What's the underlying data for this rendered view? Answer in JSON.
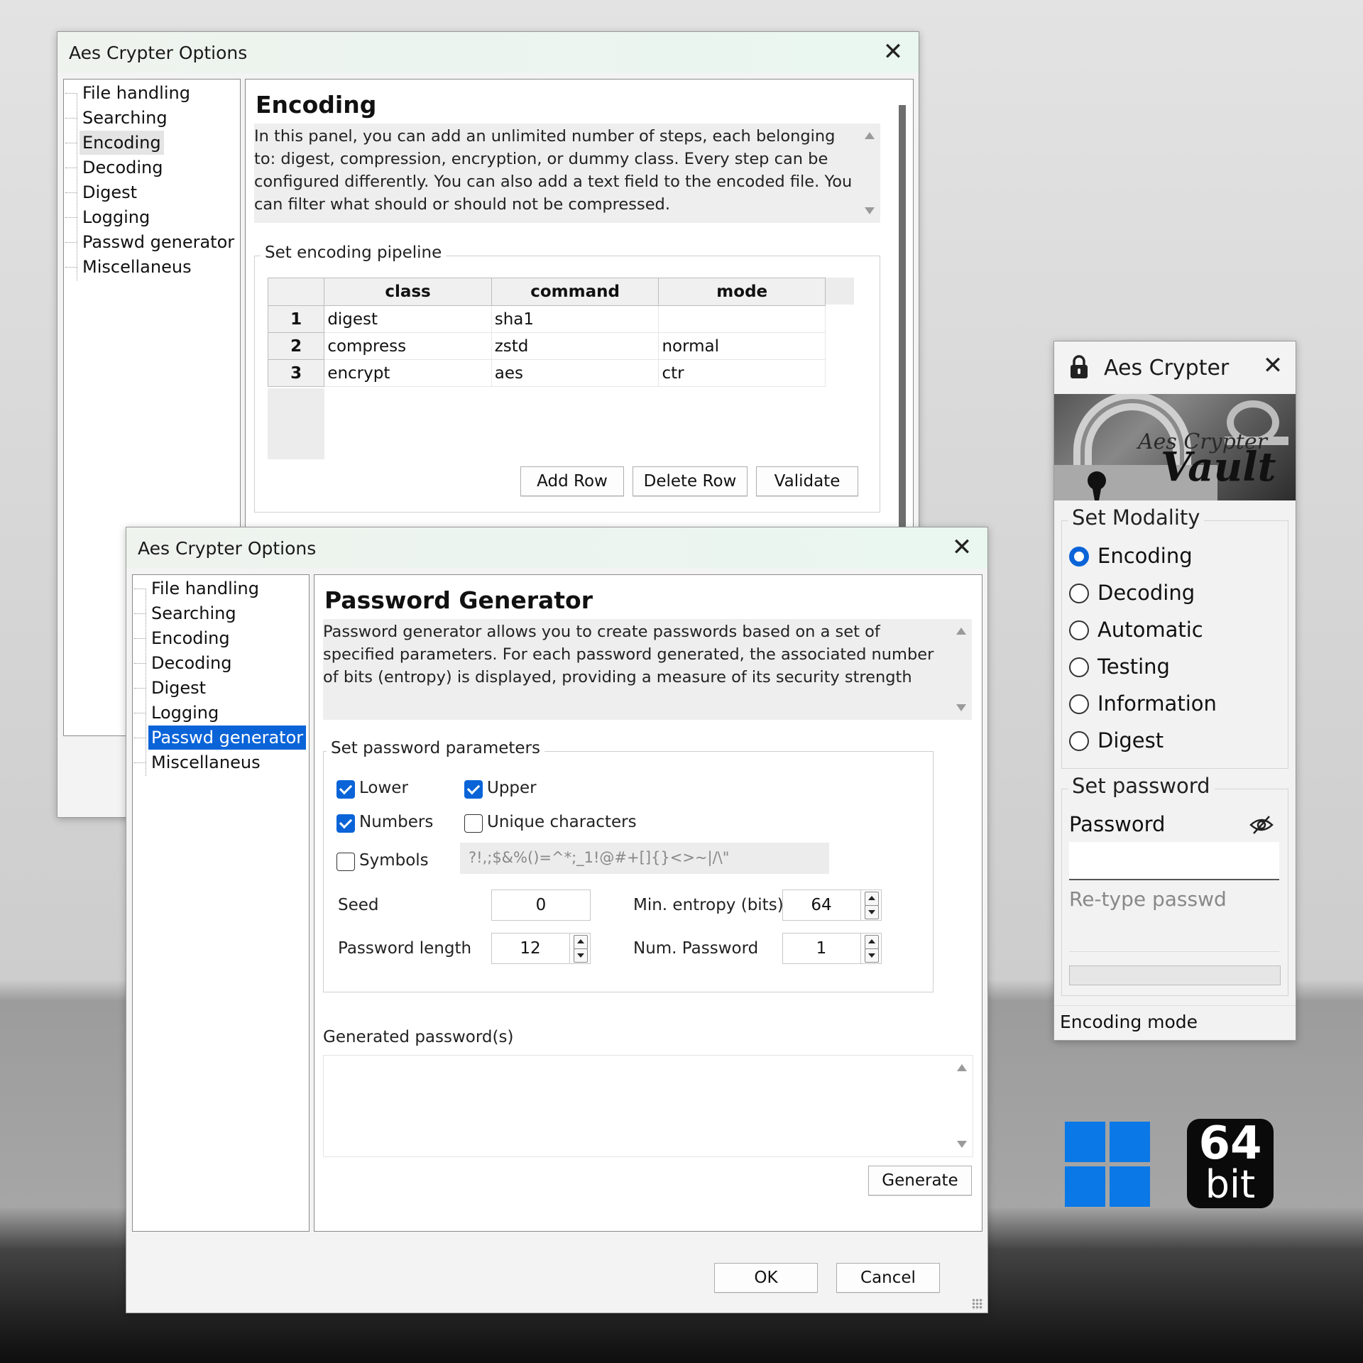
{
  "options_back": {
    "title": "Aes Crypter Options",
    "tree": [
      "File handling",
      "Searching",
      "Encoding",
      "Decoding",
      "Digest",
      "Logging",
      "Passwd generator",
      "Miscellaneus"
    ],
    "panel_title": "Encoding",
    "description": "In this panel, you can add an unlimited number of steps, each belonging to: digest, compression, encryption, or dummy class. Every step can be configured differently. You can also add a text field to the encoded file. You can filter what should or should not be compressed.",
    "pipeline": {
      "group_label": "Set encoding pipeline",
      "columns": [
        "class",
        "command",
        "mode"
      ],
      "rows": [
        {
          "n": "1",
          "class": "digest",
          "command": "sha1",
          "mode": ""
        },
        {
          "n": "2",
          "class": "compress",
          "command": "zstd",
          "mode": "normal"
        },
        {
          "n": "3",
          "class": "encrypt",
          "command": "aes",
          "mode": "ctr"
        }
      ],
      "add_row": "Add Row",
      "delete_row": "Delete Row",
      "validate": "Validate"
    }
  },
  "options_front": {
    "title": "Aes Crypter Options",
    "tree": [
      "File handling",
      "Searching",
      "Encoding",
      "Decoding",
      "Digest",
      "Logging",
      "Passwd generator",
      "Miscellaneus"
    ],
    "panel_title": "Password Generator",
    "description": "Password generator allows you to create passwords based on a set of specified parameters. For each password generated, the associated number of bits (entropy) is displayed, providing a measure of its security strength",
    "params": {
      "group_label": "Set password parameters",
      "lower": {
        "label": "Lower",
        "checked": true
      },
      "upper": {
        "label": "Upper",
        "checked": true
      },
      "numbers": {
        "label": "Numbers",
        "checked": true
      },
      "unique": {
        "label": "Unique characters",
        "checked": false
      },
      "symbols": {
        "label": "Symbols",
        "checked": false
      },
      "symbol_set": "?!,;$&%()=^*;_1!@#+[]{}<>~|/\\\"",
      "seed_label": "Seed",
      "seed": "0",
      "min_entropy_label": "Min. entropy (bits)",
      "min_entropy": "64",
      "length_label": "Password length",
      "length": "12",
      "num_label": "Num. Password",
      "num": "1"
    },
    "generated_label": "Generated password(s)",
    "generate": "Generate",
    "ok": "OK",
    "cancel": "Cancel"
  },
  "crypter": {
    "title": "Aes Crypter",
    "banner_line1": "Aes Crypter",
    "banner_line2": "Vault",
    "modality_label": "Set Modality",
    "modalities": [
      "Encoding",
      "Decoding",
      "Automatic",
      "Testing",
      "Information",
      "Digest"
    ],
    "selected_modality": "Encoding",
    "password_group": "Set password",
    "password_label": "Password",
    "retype_placeholder": "Re-type passwd",
    "status": "Encoding mode"
  },
  "badges": {
    "bits_number": "64",
    "bits_word": "bit",
    "windows_color": "#0a78e6"
  },
  "colors": {
    "accent": "#0a64d8"
  }
}
